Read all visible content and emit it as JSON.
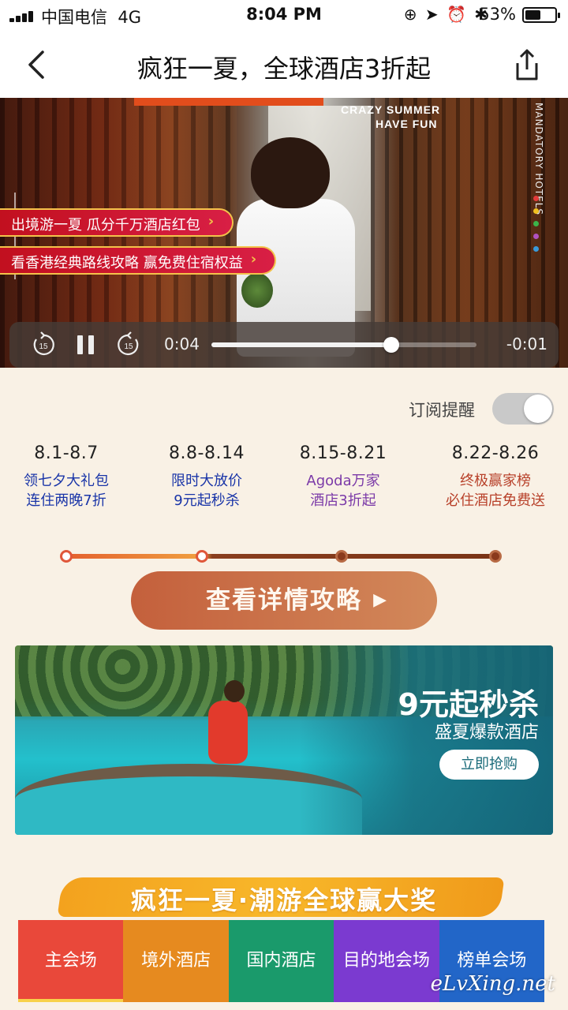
{
  "status": {
    "carrier": "中国电信",
    "network": "4G",
    "time": "8:04 PM",
    "battery": "53%",
    "battery_level": 0.53
  },
  "nav": {
    "title": "疯狂一夏，全球酒店3折起"
  },
  "video": {
    "promo_pills": [
      "出境游一夏 瓜分千万酒店红包",
      "看香港经典路线攻略 赢免费住宿权益"
    ],
    "overlay_text": [
      "CRAZY SUMMER",
      "HAVE FUN"
    ],
    "brand_text": "MANDATORY HOTELS",
    "time_current": "0:04",
    "time_remaining": "-0:01",
    "progress": 0.68,
    "skip_back_label": "15",
    "skip_forward_label": "15"
  },
  "subscribe": {
    "label": "订阅提醒",
    "enabled": false
  },
  "schedule": [
    {
      "date": "8.1-8.7",
      "line1": "领七夕大礼包",
      "line2": "连住两晚7折",
      "color": "#1a35a8"
    },
    {
      "date": "8.8-8.14",
      "line1": "限时大放价",
      "line2": "9元起秒杀",
      "color": "#1a35a8"
    },
    {
      "date": "8.15-8.21",
      "line1": "Agoda万家",
      "line2": "酒店3折起",
      "color": "#7b3aa8"
    },
    {
      "date": "8.22-8.26",
      "line1": "终极赢家榜",
      "line2": "必住酒店免费送",
      "color": "#b8412a"
    }
  ],
  "cta": {
    "label": "查看详情攻略"
  },
  "promo_banner": {
    "title": "9元起秒杀",
    "subtitle": "盛夏爆款酒店",
    "button": "立即抢购"
  },
  "section": {
    "title": "疯狂一夏·潮游全球赢大奖"
  },
  "tabs": [
    {
      "label": "主会场",
      "color": "#e9483a"
    },
    {
      "label": "境外酒店",
      "color": "#e68a1f"
    },
    {
      "label": "国内酒店",
      "color": "#1a9a6b"
    },
    {
      "label": "目的地会场",
      "color": "#7b3ad0"
    },
    {
      "label": "榜单会场",
      "color": "#2266c8"
    }
  ],
  "watermark": "eLvXing.net"
}
